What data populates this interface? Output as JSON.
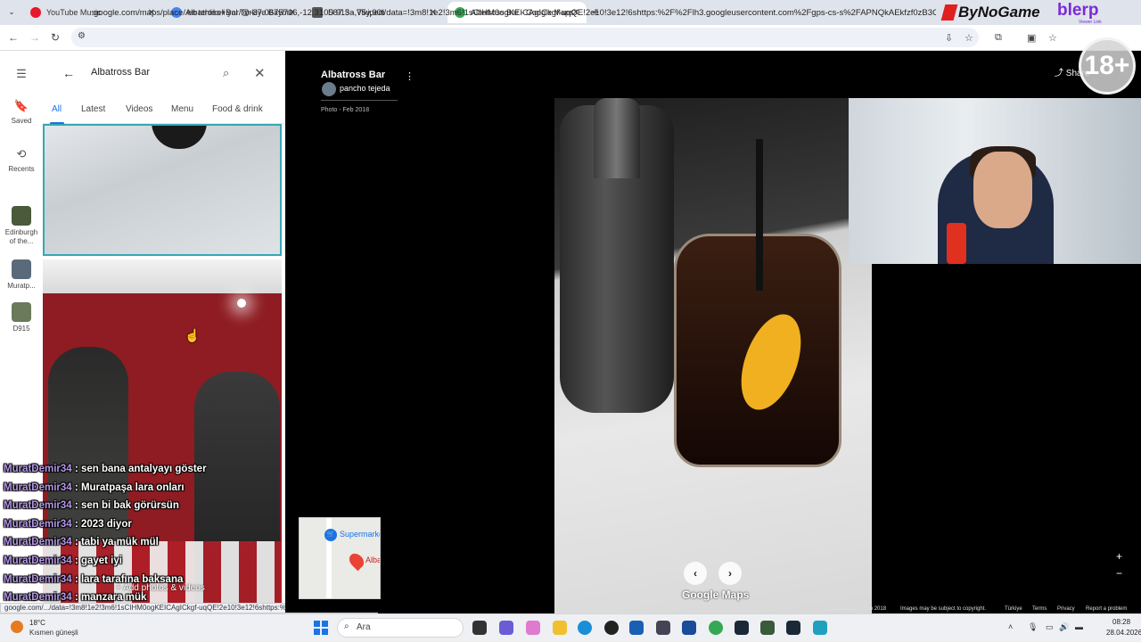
{
  "browser": {
    "tabs": [
      {
        "title": "YouTube Music",
        "icon": "youtube-music-icon",
        "color": "#e8182c"
      },
      {
        "title": "en tehlikeli yol Türkiye Bayburt",
        "icon": "google-icon",
        "color": "#4285f4"
      },
      {
        "title": "D 915 - Vikipedi",
        "icon": "wikipedia-icon",
        "color": "#333333"
      },
      {
        "title": "Albatross Bar - Google Maps",
        "icon": "google-maps-icon",
        "color": "#34a853"
      }
    ],
    "url": "google.com/maps/place/Albatross+Bar/@-37.0675706,-12.310587.3a,75y,90t/data=!3m8!1e2!3m6!1sCIHM0ogKEICAgICkgf-uqQE!2e10!3e12!6shttps:%2F%2Flh3.googleusercontent.com%2Fgps-cs-s%2FAPNQkAEkfzf0zB3CNIqPQ..."
  },
  "overlay": {
    "bynogame": "ByNoGame",
    "blerp": "blerp",
    "blerp_sub": "Viewer Link",
    "age_badge": "18+"
  },
  "rail": {
    "saved": "Saved",
    "recents": "Recents",
    "recent1": "Edinburgh of the...",
    "recent2": "Muratp...",
    "recent3": "D915"
  },
  "search": {
    "query": "Albatross Bar",
    "tabs": [
      "All",
      "Latest",
      "Videos",
      "Menu",
      "Food & drink"
    ],
    "add_photos": "Add photos & videos",
    "status_url": "google.com/.../data=!3m8!1e2!3m6!1sCIHM0ogKEICAgICkgf-uqQE!2e10!3e12!6shttps:%2F%2Flh3.googleuserconten..."
  },
  "chat": [
    {
      "user": "MuratDemir34",
      "msg": "sen bana antalyayı göster"
    },
    {
      "user": "MuratDemir34",
      "msg": "Muratpaşa lara onları"
    },
    {
      "user": "MuratDemir34",
      "msg": "sen bi bak görürsün"
    },
    {
      "user": "MuratDemir34",
      "msg": "2023 diyor"
    },
    {
      "user": "MuratDemir34",
      "msg": "tabi ya mük mül"
    },
    {
      "user": "MuratDemir34",
      "msg": "gayet iyi"
    },
    {
      "user": "MuratDemir34",
      "msg": "lara tarafına baksana"
    },
    {
      "user": "MuratDemir34",
      "msg": "manzara mük"
    }
  ],
  "viewer": {
    "place": "Albatross Bar",
    "contributor": "pancho tejeda",
    "date": "Photo - Feb 2018",
    "share": "Share",
    "brand": "Google Maps",
    "minimap_label1": "Supermarke",
    "minimap_label2": "Alba",
    "footer": [
      "Image capture: Feb 2018",
      "Images may be subject to copyright.",
      "Türkiye",
      "Terms",
      "Privacy",
      "Report a problem"
    ]
  },
  "taskbar": {
    "temp": "18°C",
    "weather": "Kısmen güneşli",
    "search_placeholder": "Ara",
    "time": "08:28",
    "date": "28.04.2026"
  }
}
